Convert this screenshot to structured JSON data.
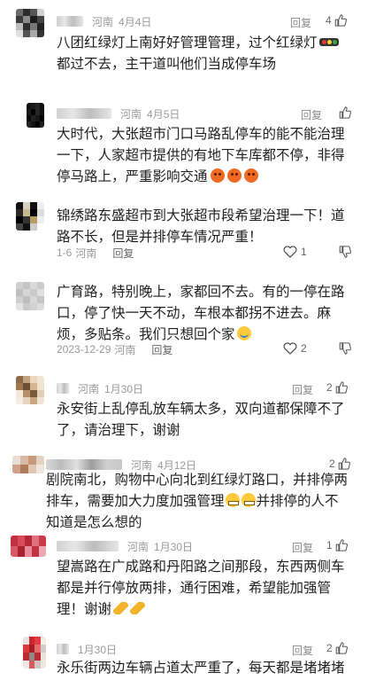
{
  "comments": [
    {
      "location": "河南",
      "date": "4月4日",
      "reply_label": "回复",
      "likes": "4",
      "text_parts": [
        "八团红绿灯上南好好管理管理，过个红绿灯",
        "都过不去，主干道叫他们当成停车场"
      ]
    },
    {
      "location": "河南",
      "date": "4月5日",
      "reply_label": "回复",
      "likes": "",
      "text": "大时代，大张超市门口马路乱停车的能不能治理一下，人家超市提供的有地下车库都不停，非得停马路上，严重影响交通"
    },
    {
      "location": "河南",
      "date": "1-6",
      "reply_label": "回复",
      "likes": "1",
      "text": "锦绣路东盛超市到大张超市段希望治理一下！道路不长，但是并排停车情况严重！"
    },
    {
      "location": "河南",
      "date": "2023-12-29",
      "reply_label": "回复",
      "likes": "2",
      "text": "广育路，特别晚上，家都回不去。有的一停在路口，停了快一天不动，车根本都拐不进去。麻烦，多贴条。我们只想回个家"
    },
    {
      "location": "河南",
      "date": "1月30日",
      "reply_label": "回复",
      "likes": "2",
      "text": "永安街上乱停乱放车辆太多，双向道都保障不了了，请治理下，谢谢"
    },
    {
      "location": "河南",
      "date": "4月12日",
      "reply_label": "",
      "likes": "2",
      "text_parts": [
        "剧院南北，购物中心向北到红绿灯路口，并排停两排车，需要加大力度加强管理",
        "并排停的人不知道是怎么想的"
      ]
    },
    {
      "location": "河南",
      "date": "1月30日",
      "reply_label": "回复",
      "likes": "1",
      "text": "望嵩路在广成路和丹阳路之间那段，东西两侧车都是并行停放两排，通行困难，希望能加强管理！谢谢"
    },
    {
      "location": "",
      "date": "1月30日",
      "reply_label": "回复",
      "likes": "2",
      "text": "永乐街两边车辆占道太严重了，每天都是堵堵堵"
    }
  ],
  "icons": {
    "like": "thumbs-up-icon",
    "dislike": "thumbs-down-icon"
  }
}
